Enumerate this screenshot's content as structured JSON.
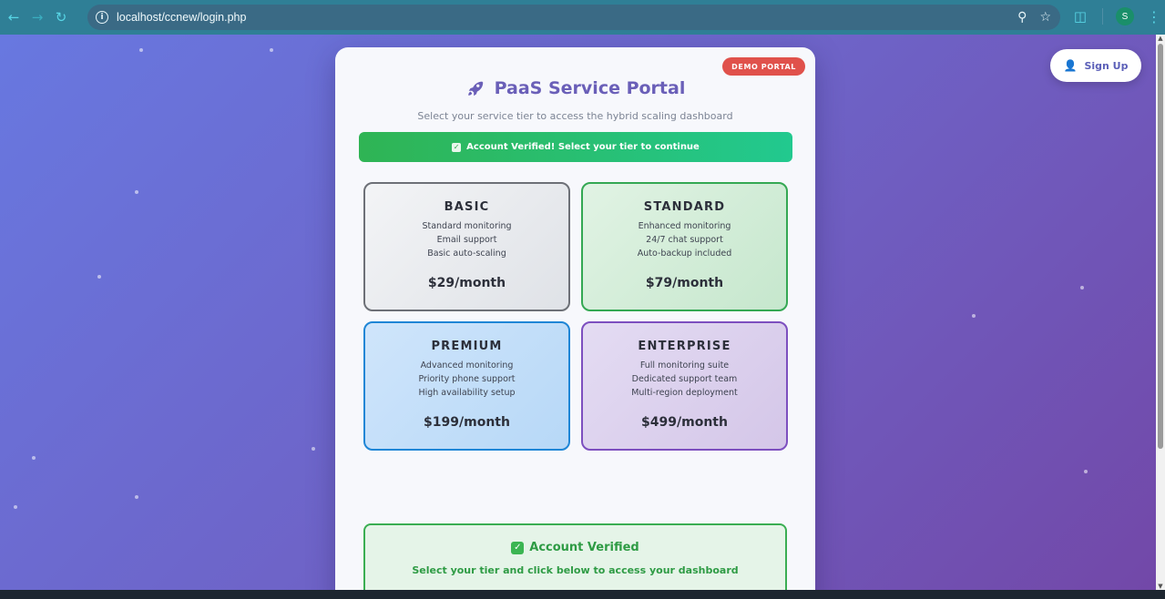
{
  "browser": {
    "url": "localhost/ccnew/login.php",
    "profile_initial": "S"
  },
  "page": {
    "signup_label": "Sign Up",
    "badge": "DEMO PORTAL",
    "title": "PaaS Service Portal",
    "subtitle": "Select your service tier to access the hybrid scaling dashboard",
    "banner_text": "Account Verified! Select your tier to continue",
    "tiers": [
      {
        "name": "BASIC",
        "features": [
          "Standard monitoring",
          "Email support",
          "Basic auto-scaling"
        ],
        "price": "$29/month"
      },
      {
        "name": "STANDARD",
        "features": [
          "Enhanced monitoring",
          "24/7 chat support",
          "Auto-backup included"
        ],
        "price": "$79/month"
      },
      {
        "name": "PREMIUM",
        "features": [
          "Advanced monitoring",
          "Priority phone support",
          "High availability setup"
        ],
        "price": "$199/month"
      },
      {
        "name": "ENTERPRISE",
        "features": [
          "Full monitoring suite",
          "Dedicated support team",
          "Multi-region deployment"
        ],
        "price": "$499/month"
      }
    ],
    "verified_box": {
      "title": "Account Verified",
      "text": "Select your tier and click below to access your dashboard"
    }
  },
  "colors": {
    "accent": "#6a5fb8",
    "demo_badge": "#e0514b",
    "verified_green": "#2e9b44"
  }
}
